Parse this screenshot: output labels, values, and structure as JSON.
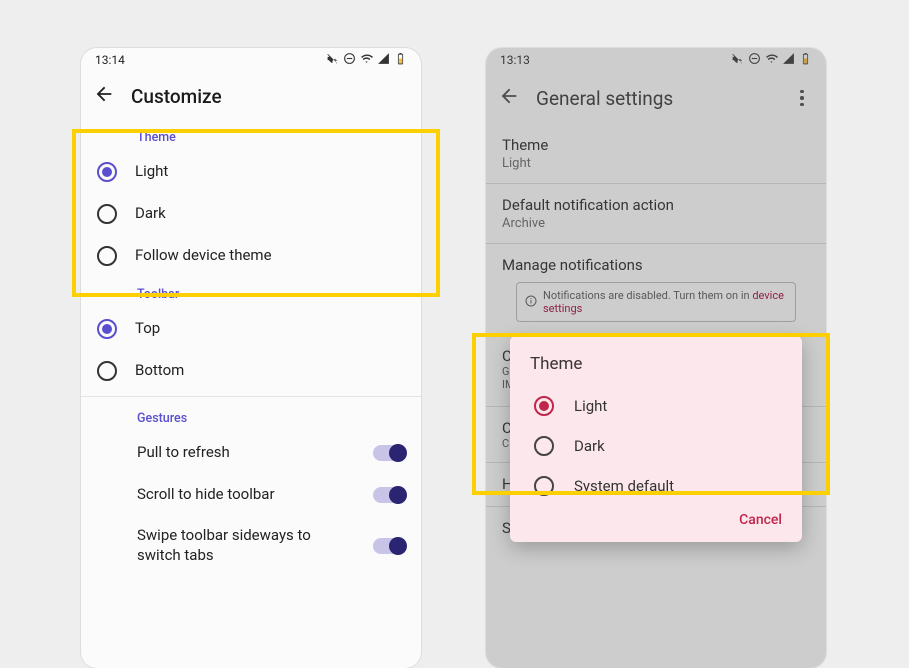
{
  "left": {
    "status": {
      "time": "13:14"
    },
    "appbar": {
      "title": "Customize"
    },
    "sections": {
      "theme": {
        "header": "Theme",
        "options": [
          {
            "label": "Light",
            "selected": true
          },
          {
            "label": "Dark",
            "selected": false
          },
          {
            "label": "Follow device theme",
            "selected": false
          }
        ]
      },
      "toolbar": {
        "header": "Toolbar",
        "options": [
          {
            "label": "Top",
            "selected": true
          },
          {
            "label": "Bottom",
            "selected": false
          }
        ]
      },
      "gestures": {
        "header": "Gestures",
        "switches": [
          {
            "label": "Pull to refresh",
            "on": true
          },
          {
            "label": "Scroll to hide toolbar",
            "on": true
          },
          {
            "label": "Swipe toolbar sideways to switch tabs",
            "on": true
          }
        ]
      }
    }
  },
  "right": {
    "status": {
      "time": "13:13"
    },
    "appbar": {
      "title": "General settings"
    },
    "items": [
      {
        "primary": "Theme",
        "secondary": "Light"
      },
      {
        "primary": "Default notification action",
        "secondary": "Archive"
      },
      {
        "primary": "Manage notifications"
      }
    ],
    "notice": {
      "text": "Notifications are disabled. Turn them on in ",
      "link": "device settings"
    },
    "obscured": [
      {
        "primary": "C",
        "secondary_lines": [
          "G",
          "IM"
        ]
      },
      {
        "primary": "C",
        "secondary_lines": [
          "C"
        ]
      },
      {
        "primary": "H"
      },
      {
        "primary": "Swipe actions"
      }
    ],
    "dialog": {
      "title": "Theme",
      "options": [
        {
          "label": "Light",
          "selected": true
        },
        {
          "label": "Dark",
          "selected": false
        },
        {
          "label": "System default",
          "selected": false
        }
      ],
      "cancel": "Cancel"
    }
  }
}
